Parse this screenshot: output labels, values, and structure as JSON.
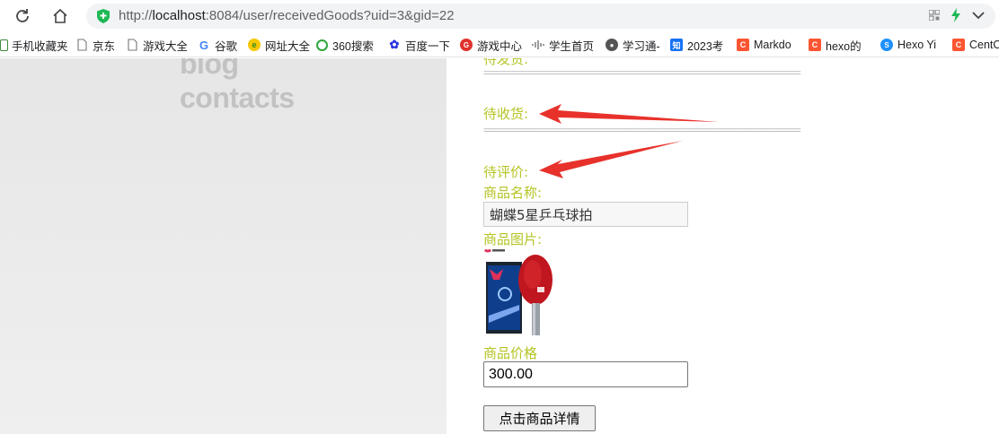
{
  "browser": {
    "url_prefix": "http://",
    "url_host": "localhost",
    "url_rest": ":8084/user/receivedGoods?uid=3&gid=22"
  },
  "bookmarks": [
    {
      "label": "手机收藏夹",
      "icon": "phone-icon",
      "color": "#3c8a3c"
    },
    {
      "label": "京东",
      "icon": "page-icon",
      "color": "#888888"
    },
    {
      "label": "游戏大全",
      "icon": "page-icon",
      "color": "#888888"
    },
    {
      "label": "谷歌",
      "icon": "google-icon",
      "color": "#4285f4"
    },
    {
      "label": "网址大全",
      "icon": "url-nav-icon",
      "color": "#2a8b2a"
    },
    {
      "label": "360搜索",
      "icon": "360-icon",
      "color": "#2fa53a"
    },
    {
      "label": "百度一下",
      "icon": "baidu-paw-icon",
      "color": "#2932e1"
    },
    {
      "label": "游戏中心",
      "icon": "game-center-icon",
      "color": "#e0312b"
    },
    {
      "label": "学生首页",
      "icon": "audio-bars-icon",
      "color": "#7a7a7a"
    },
    {
      "label": "学习通-",
      "icon": "globe-icon",
      "color": "#555555"
    },
    {
      "label": "2023考",
      "icon": "zhihu-icon",
      "color": "#1772f6"
    },
    {
      "label": "Markdo",
      "icon": "csdn-icon",
      "color": "#fc5531"
    },
    {
      "label": "hexo的",
      "icon": "csdn-icon",
      "color": "#fc5531"
    },
    {
      "label": "Hexo Yi",
      "icon": "hexo-icon",
      "color": "#1e90ff"
    },
    {
      "label": "CentO",
      "icon": "csdn-icon",
      "color": "#fc5531"
    }
  ],
  "sidebar": {
    "line1": "blog",
    "line2": "contacts"
  },
  "orders": {
    "pending_ship_label": "待发货:",
    "pending_receive_label": "待收货:",
    "pending_review_label": "待评价:",
    "divider": "=================================================================================="
  },
  "product": {
    "name_label": "商品名称:",
    "name_value": "蝴蝶5星乒乓球拍",
    "image_label": "商品图片:",
    "price_label": "商品价格",
    "price_value": "300.00",
    "detail_button": "点击商品详情"
  },
  "colors": {
    "label_green": "#b5c424",
    "arrow_red": "#e8312b"
  }
}
